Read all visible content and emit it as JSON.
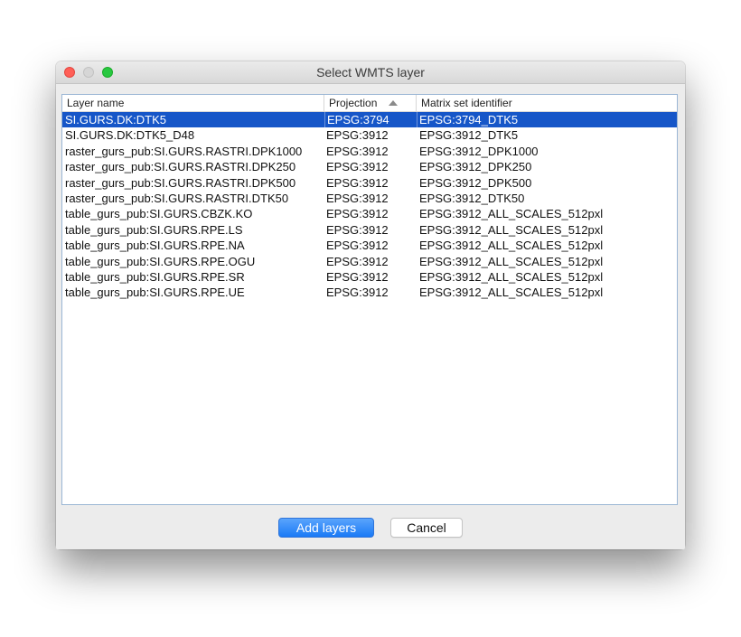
{
  "window": {
    "title": "Select WMTS layer"
  },
  "table": {
    "columns": [
      {
        "label": "Layer name"
      },
      {
        "label": "Projection",
        "sort": "ascending"
      },
      {
        "label": "Matrix set identifier"
      }
    ],
    "selected_row": 0,
    "rows": [
      {
        "layer": "SI.GURS.DK:DTK5",
        "projection": "EPSG:3794",
        "matrix": "EPSG:3794_DTK5"
      },
      {
        "layer": "SI.GURS.DK:DTK5_D48",
        "projection": "EPSG:3912",
        "matrix": "EPSG:3912_DTK5"
      },
      {
        "layer": "raster_gurs_pub:SI.GURS.RASTRI.DPK1000",
        "projection": "EPSG:3912",
        "matrix": "EPSG:3912_DPK1000"
      },
      {
        "layer": "raster_gurs_pub:SI.GURS.RASTRI.DPK250",
        "projection": "EPSG:3912",
        "matrix": "EPSG:3912_DPK250"
      },
      {
        "layer": "raster_gurs_pub:SI.GURS.RASTRI.DPK500",
        "projection": "EPSG:3912",
        "matrix": "EPSG:3912_DPK500"
      },
      {
        "layer": "raster_gurs_pub:SI.GURS.RASTRI.DTK50",
        "projection": "EPSG:3912",
        "matrix": "EPSG:3912_DTK50"
      },
      {
        "layer": "table_gurs_pub:SI.GURS.CBZK.KO",
        "projection": "EPSG:3912",
        "matrix": "EPSG:3912_ALL_SCALES_512pxl"
      },
      {
        "layer": "table_gurs_pub:SI.GURS.RPE.LS",
        "projection": "EPSG:3912",
        "matrix": "EPSG:3912_ALL_SCALES_512pxl"
      },
      {
        "layer": "table_gurs_pub:SI.GURS.RPE.NA",
        "projection": "EPSG:3912",
        "matrix": "EPSG:3912_ALL_SCALES_512pxl"
      },
      {
        "layer": "table_gurs_pub:SI.GURS.RPE.OGU",
        "projection": "EPSG:3912",
        "matrix": "EPSG:3912_ALL_SCALES_512pxl"
      },
      {
        "layer": "table_gurs_pub:SI.GURS.RPE.SR",
        "projection": "EPSG:3912",
        "matrix": "EPSG:3912_ALL_SCALES_512pxl"
      },
      {
        "layer": "table_gurs_pub:SI.GURS.RPE.UE",
        "projection": "EPSG:3912",
        "matrix": "EPSG:3912_ALL_SCALES_512pxl"
      }
    ]
  },
  "buttons": {
    "add_label": "Add layers",
    "cancel_label": "Cancel"
  },
  "colors": {
    "selection": "#1656c8",
    "primary_button": "#1a7af6",
    "close": "#ff5f57",
    "minimize": "#d6d6d6",
    "maximize": "#28c840"
  },
  "icons": {
    "close": "close-dot-icon",
    "minimize": "minimize-dot-icon",
    "maximize": "maximize-dot-icon",
    "sort": "sort-ascending-icon"
  }
}
